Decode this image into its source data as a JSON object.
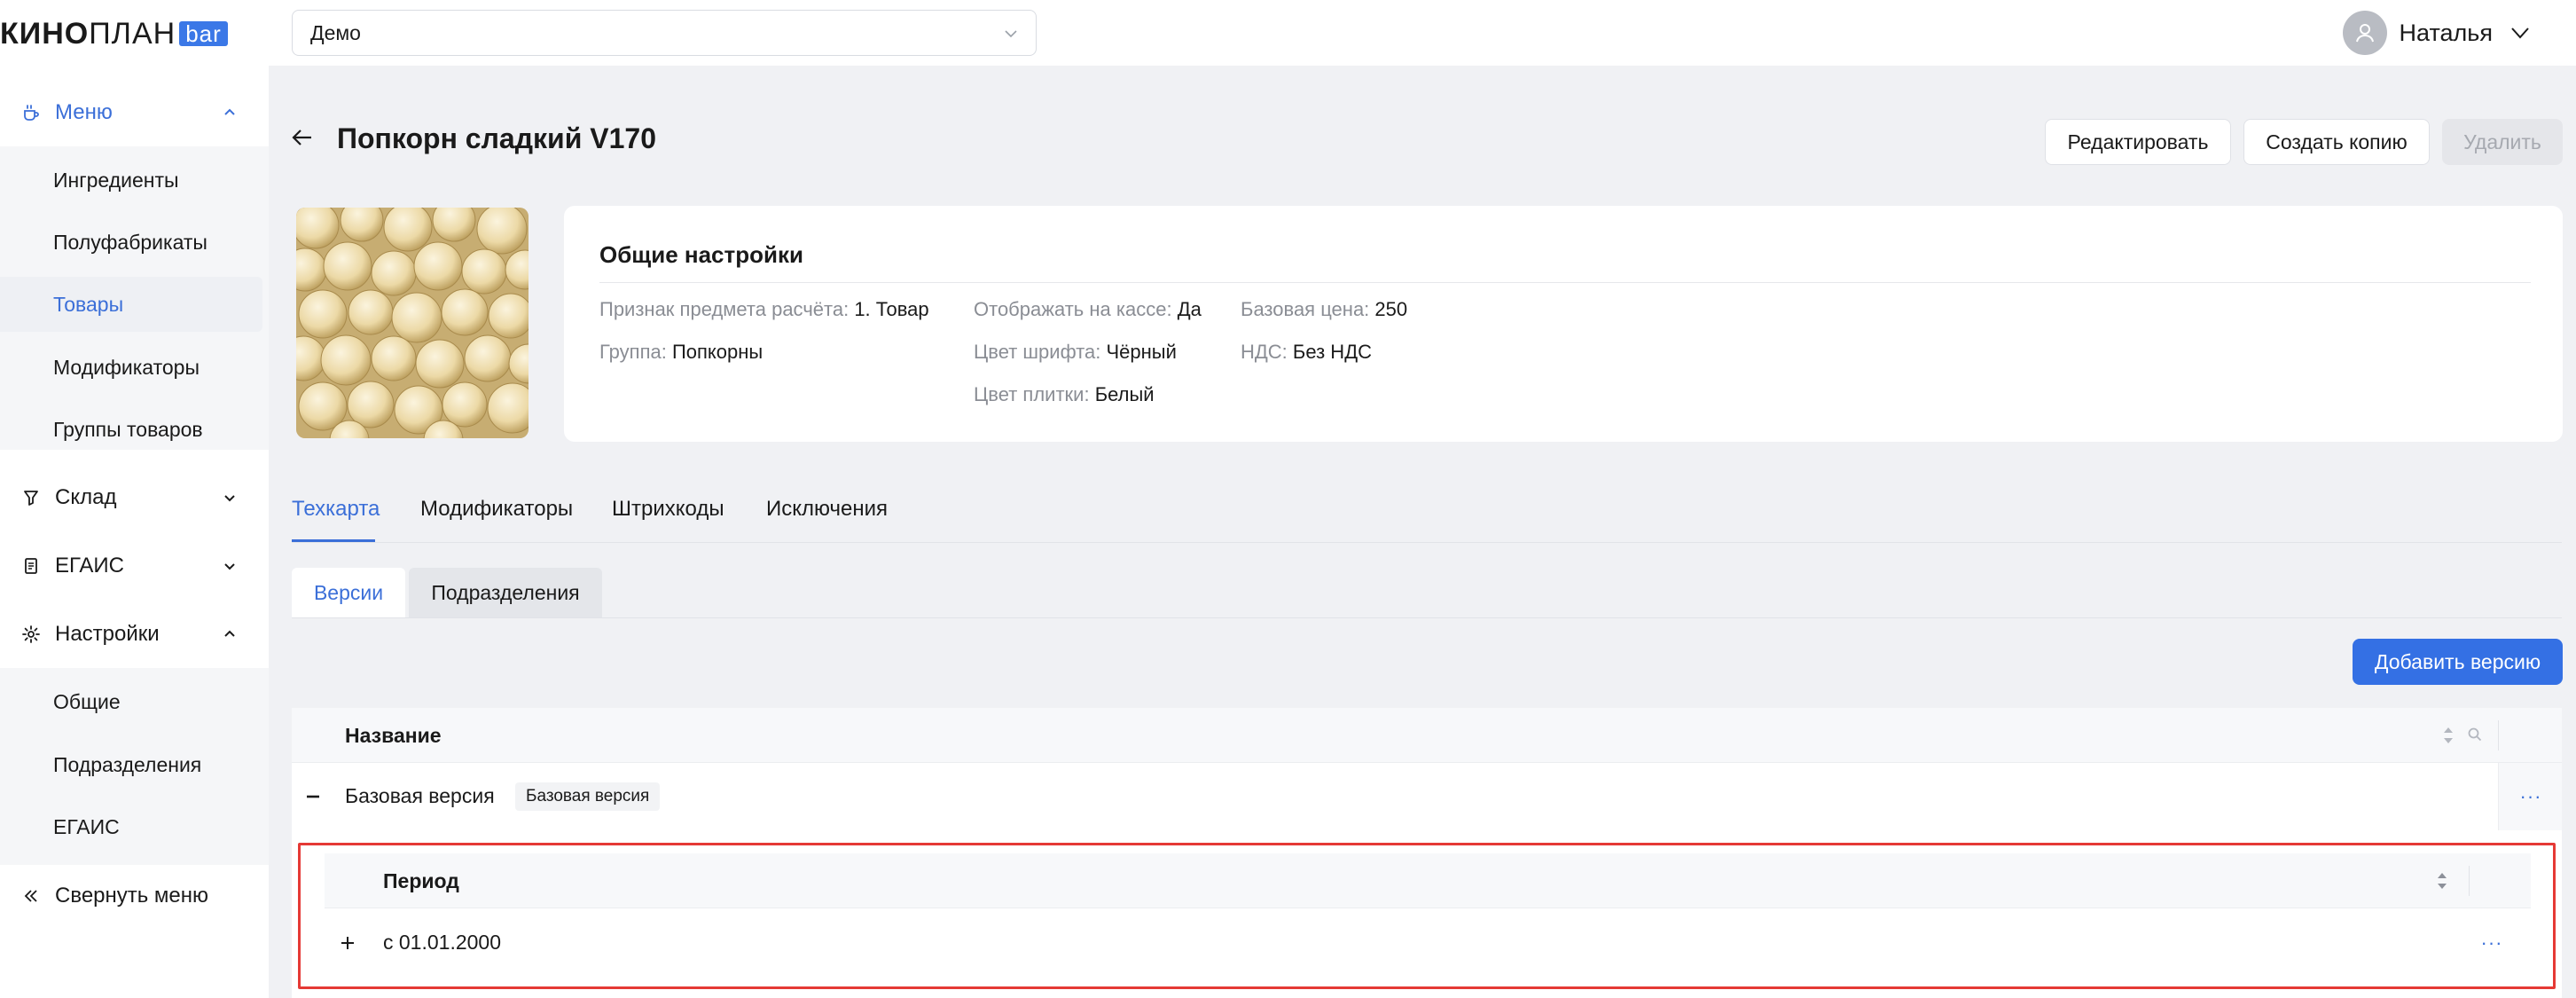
{
  "logo": {
    "bold": "КИНО",
    "light": "ПЛАН",
    "badge": "bar"
  },
  "sidebar": {
    "menu": {
      "label": "Меню",
      "icon": "coffee-cup-icon"
    },
    "menu_items": [
      {
        "label": "Ингредиенты"
      },
      {
        "label": "Полуфабрикаты"
      },
      {
        "label": "Товары"
      },
      {
        "label": "Модификаторы"
      },
      {
        "label": "Группы товаров"
      }
    ],
    "warehouse": {
      "label": "Склад",
      "icon": "funnel-glass-icon"
    },
    "egais": {
      "label": "ЕГАИС",
      "icon": "document-icon"
    },
    "settings": {
      "label": "Настройки",
      "icon": "gear-icon"
    },
    "settings_items": [
      {
        "label": "Общие"
      },
      {
        "label": "Подразделения"
      },
      {
        "label": "ЕГАИС"
      }
    ],
    "collapse": {
      "label": "Свернуть меню"
    }
  },
  "topbar": {
    "cinema_select": "Демо",
    "user_name": "Наталья"
  },
  "page": {
    "title": "Попкорн сладкий V170",
    "edit_label": "Редактировать",
    "copy_label": "Создать копию",
    "delete_label": "Удалить"
  },
  "card": {
    "title": "Общие настройки",
    "fields": {
      "payment_sign_k": "Признак предмета расчёта:",
      "payment_sign_v": "1. Товар",
      "group_k": "Группа:",
      "group_v": "Попкорны",
      "show_k": "Отображать на кассе:",
      "show_v": "Да",
      "font_color_k": "Цвет шрифта:",
      "font_color_v": "Чёрный",
      "tile_color_k": "Цвет плитки:",
      "tile_color_v": "Белый",
      "price_k": "Базовая цена:",
      "price_v": "250",
      "vat_k": "НДС:",
      "vat_v": "Без НДС"
    }
  },
  "tabs": [
    "Техкарта",
    "Модификаторы",
    "Штрихкоды",
    "Исключения"
  ],
  "subtabs": [
    "Версии",
    "Подразделения"
  ],
  "add_version_label": "Добавить версию",
  "table": {
    "header_name": "Название",
    "row_name": "Базовая версия",
    "row_badge": "Базовая версия",
    "nested_header": "Период",
    "nested_row": "с 01.01.2000"
  },
  "colors": {
    "accent": "#3b6fd8",
    "primary_button": "#3470e4",
    "highlight_border": "#e53935"
  }
}
